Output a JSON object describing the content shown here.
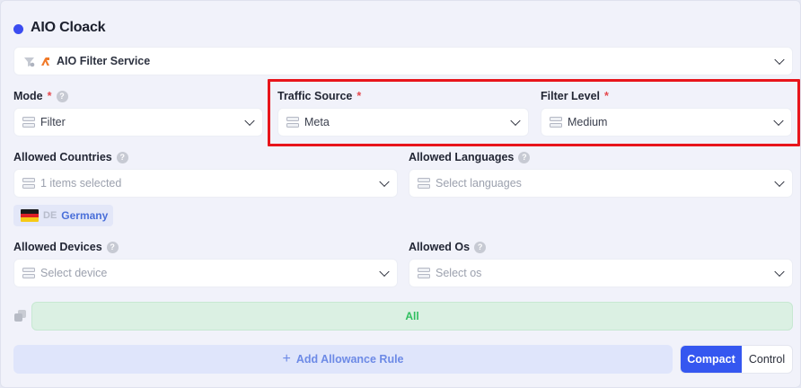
{
  "header": {
    "title": "AIO Cloack"
  },
  "service": {
    "value": "AIO Filter Service"
  },
  "mode": {
    "label": "Mode",
    "required": "*",
    "value": "Filter"
  },
  "traffic_source": {
    "label": "Traffic Source",
    "required": "*",
    "value": "Meta"
  },
  "filter_level": {
    "label": "Filter Level",
    "required": "*",
    "value": "Medium"
  },
  "allowed_countries": {
    "label": "Allowed Countries",
    "value": "1 items selected",
    "tags": [
      {
        "code": "DE",
        "name": "Germany"
      }
    ]
  },
  "allowed_languages": {
    "label": "Allowed Languages",
    "placeholder": "Select languages"
  },
  "allowed_devices": {
    "label": "Allowed Devices",
    "placeholder": "Select device"
  },
  "allowed_os": {
    "label": "Allowed Os",
    "placeholder": "Select os"
  },
  "rule": {
    "label": "All"
  },
  "actions": {
    "add_rule": "Add Allowance Rule",
    "add_symbol": "+"
  },
  "view_toggle": {
    "options": [
      "Compact",
      "Control"
    ],
    "selected": "Compact"
  },
  "help_glyph": "?",
  "colors": {
    "accent": "#3557f0",
    "highlight": "#e8151b",
    "success": "#2fbf5f"
  }
}
